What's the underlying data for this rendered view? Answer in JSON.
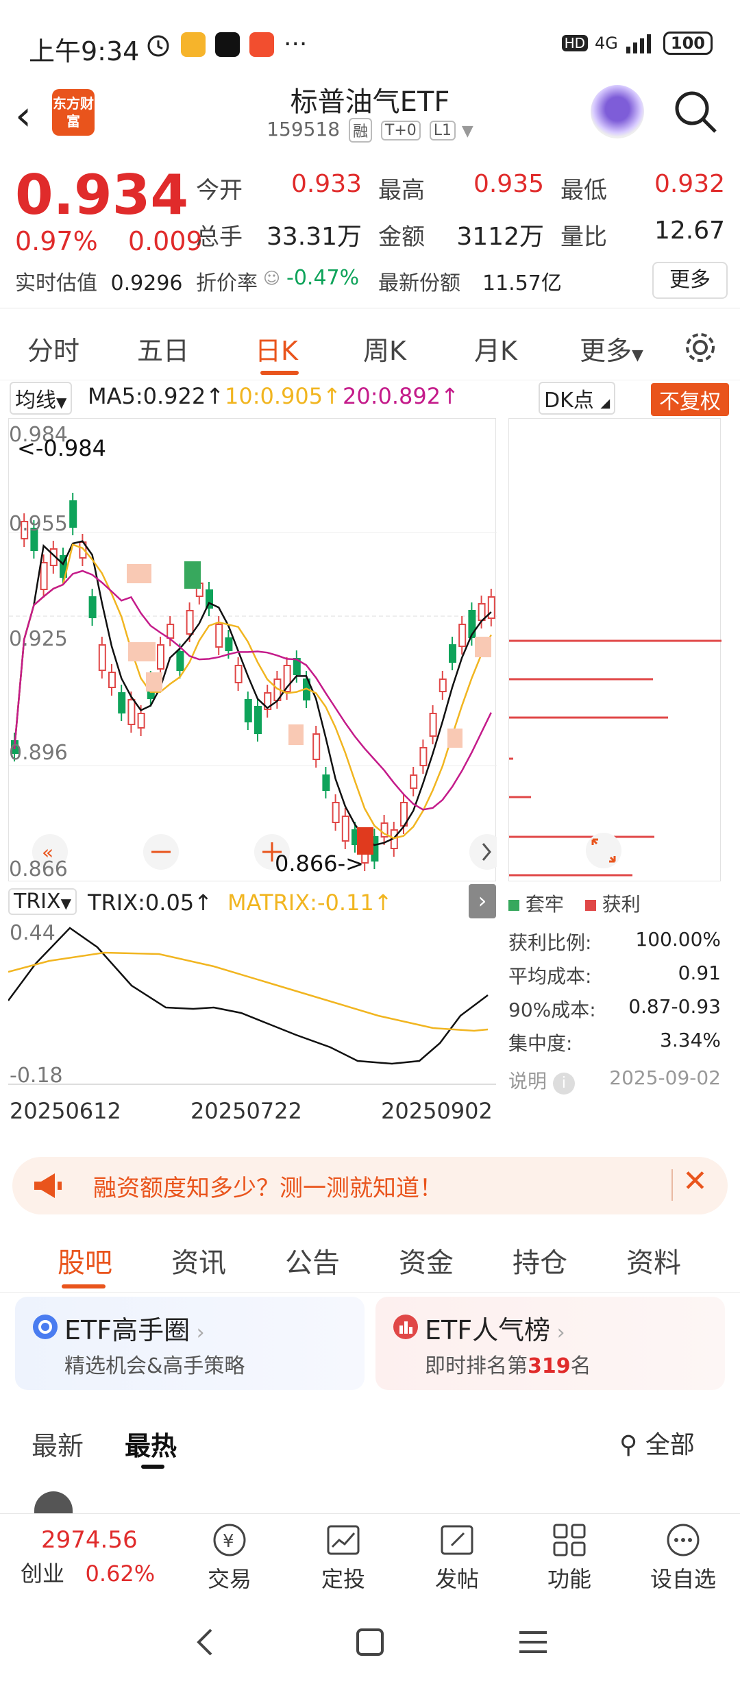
{
  "status": {
    "time": "上午9:34",
    "dots": "···",
    "net": "4G",
    "battery": "100"
  },
  "header": {
    "logo": "东方财富",
    "title": "标普油气ETF",
    "code": "159518",
    "tags": [
      "融",
      "T+0",
      "L1"
    ]
  },
  "quote": {
    "price": "0.934",
    "pct": "0.97%",
    "chg": "0.009",
    "rows": [
      [
        {
          "l": "今开",
          "v": "0.933"
        },
        {
          "l": "最高",
          "v": "0.935"
        },
        {
          "l": "最低",
          "v": "0.932"
        }
      ],
      [
        {
          "l": "总手",
          "v": "33.31万"
        },
        {
          "l": "金额",
          "v": "3112万"
        },
        {
          "l": "量比",
          "v": "12.67"
        }
      ]
    ],
    "est_label": "实时估值",
    "est": "0.9296",
    "disc_label": "折价率",
    "disc": "-0.47%",
    "share_label": "最新份额",
    "share": "11.57亿",
    "more": "更多"
  },
  "tabs": [
    "分时",
    "五日",
    "日K",
    "周K",
    "月K",
    "更多"
  ],
  "ma": {
    "btn": "均线",
    "ma5": "MA5:0.922↑",
    "ma10": "10:0.905↑",
    "ma20": "20:0.892↑",
    "dk": "DK点",
    "fq": "不复权"
  },
  "kchart": {
    "yticks": [
      "0.984",
      "0.955",
      "0.925",
      "0.896",
      "0.866"
    ],
    "hi": "<-0.984",
    "lo": "0.866->"
  },
  "trix": {
    "btn": "TRIX",
    "trix": "TRIX:0.05↑",
    "matrix": "MATRIX:-0.11↑",
    "top": "0.44",
    "bottom": "-0.18"
  },
  "dates": [
    "20250612",
    "20250722",
    "20250902"
  ],
  "dist": {
    "legend_a": "套牢",
    "legend_b": "获利",
    "rows": [
      {
        "l": "获利比例:",
        "v": "100.00%"
      },
      {
        "l": "平均成本:",
        "v": "0.91"
      },
      {
        "l": "90%成本:",
        "v": "0.87-0.93"
      },
      {
        "l": "集中度:",
        "v": "3.34%"
      }
    ],
    "note": "说明",
    "date": "2025-09-02"
  },
  "banner": "融资额度知多少？测一测就知道！",
  "subtabs": [
    "股吧",
    "资讯",
    "公告",
    "资金",
    "持仓",
    "资料"
  ],
  "cards": [
    {
      "t": "ETF高手圈",
      "s": "精选机会&高手策略"
    },
    {
      "t": "ETF人气榜",
      "s1": "即时排名第",
      "rank": "319",
      "s2": "名"
    }
  ],
  "sort": {
    "a": "最新",
    "b": "最热",
    "filter": "全部"
  },
  "bottom": {
    "index": "2974.56",
    "name": "创业",
    "pct": "0.62%",
    "items": [
      "交易",
      "定投",
      "发帖",
      "功能",
      "设自选"
    ]
  },
  "colors": {
    "accent": "#e9541c",
    "up": "#e02b2b",
    "down": "#0ea35a"
  }
}
